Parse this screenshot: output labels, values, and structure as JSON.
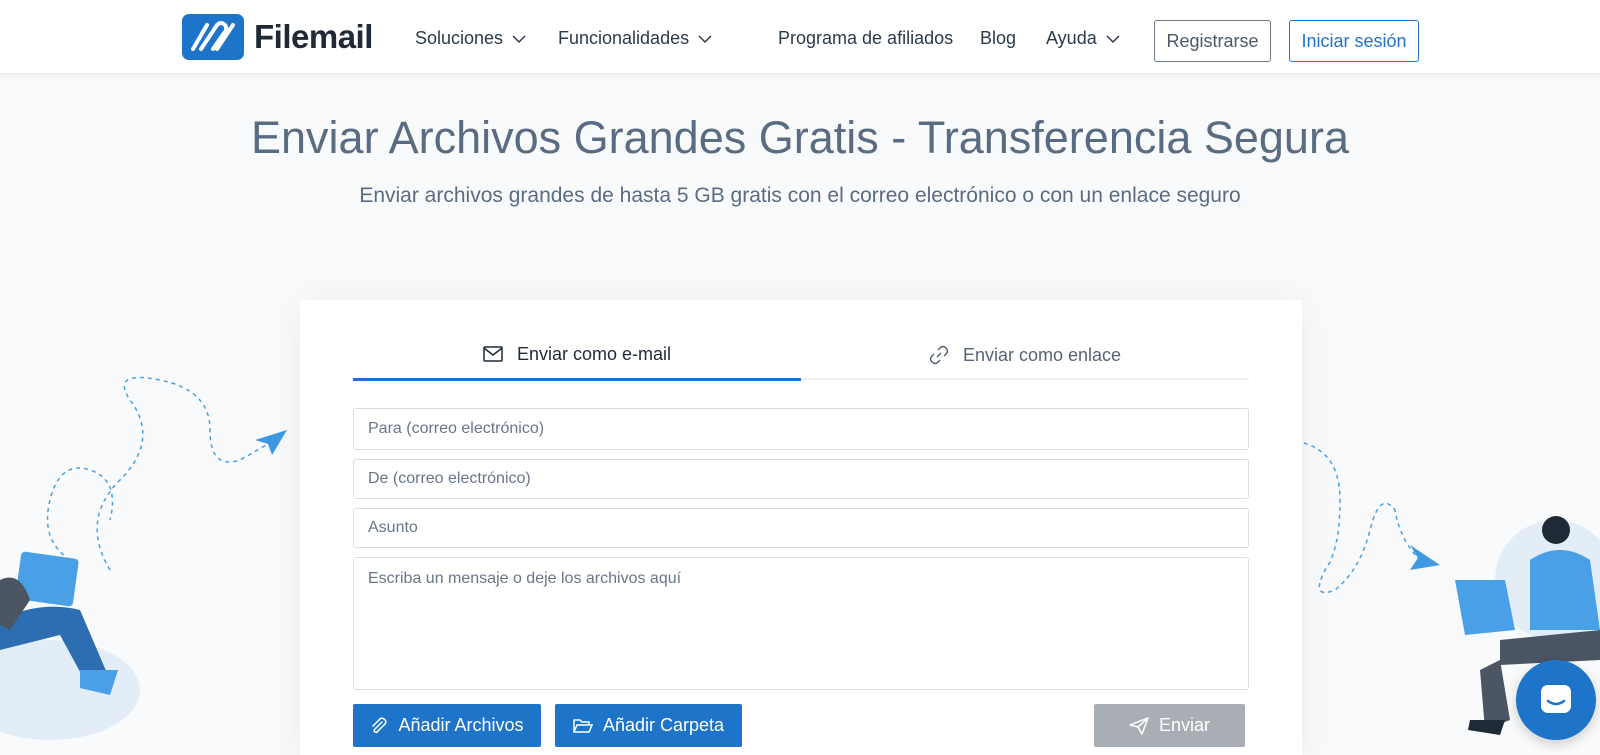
{
  "brand": {
    "name": "Filemail"
  },
  "nav": {
    "items": [
      {
        "label": "Soluciones",
        "has_dropdown": true
      },
      {
        "label": "Funcionalidades",
        "has_dropdown": true
      },
      {
        "label": "Programa de afiliados",
        "has_dropdown": false
      },
      {
        "label": "Blog",
        "has_dropdown": false
      },
      {
        "label": "Ayuda",
        "has_dropdown": true
      }
    ],
    "register_label": "Registrarse",
    "login_label": "Iniciar sesión"
  },
  "hero": {
    "title": "Enviar Archivos Grandes Gratis - Transferencia Segura",
    "subtitle": "Enviar archivos grandes de hasta 5 GB gratis con el correo electrónico o con un enlace seguro"
  },
  "form": {
    "tabs": [
      {
        "label": "Enviar como e-mail",
        "icon": "envelope-icon",
        "active": true
      },
      {
        "label": "Enviar como enlace",
        "icon": "link-icon",
        "active": false
      }
    ],
    "to_placeholder": "Para (correo electrónico)",
    "from_placeholder": "De (correo electrónico)",
    "subject_placeholder": "Asunto",
    "message_placeholder": "Escriba un mensaje o deje los archivos aquí",
    "add_files_label": "Añadir Archivos",
    "add_folder_label": "Añadir Carpeta",
    "send_label": "Enviar"
  },
  "colors": {
    "accent": "#1d74c9",
    "disabled": "#a9aeb4",
    "heading": "#5a6c81"
  }
}
